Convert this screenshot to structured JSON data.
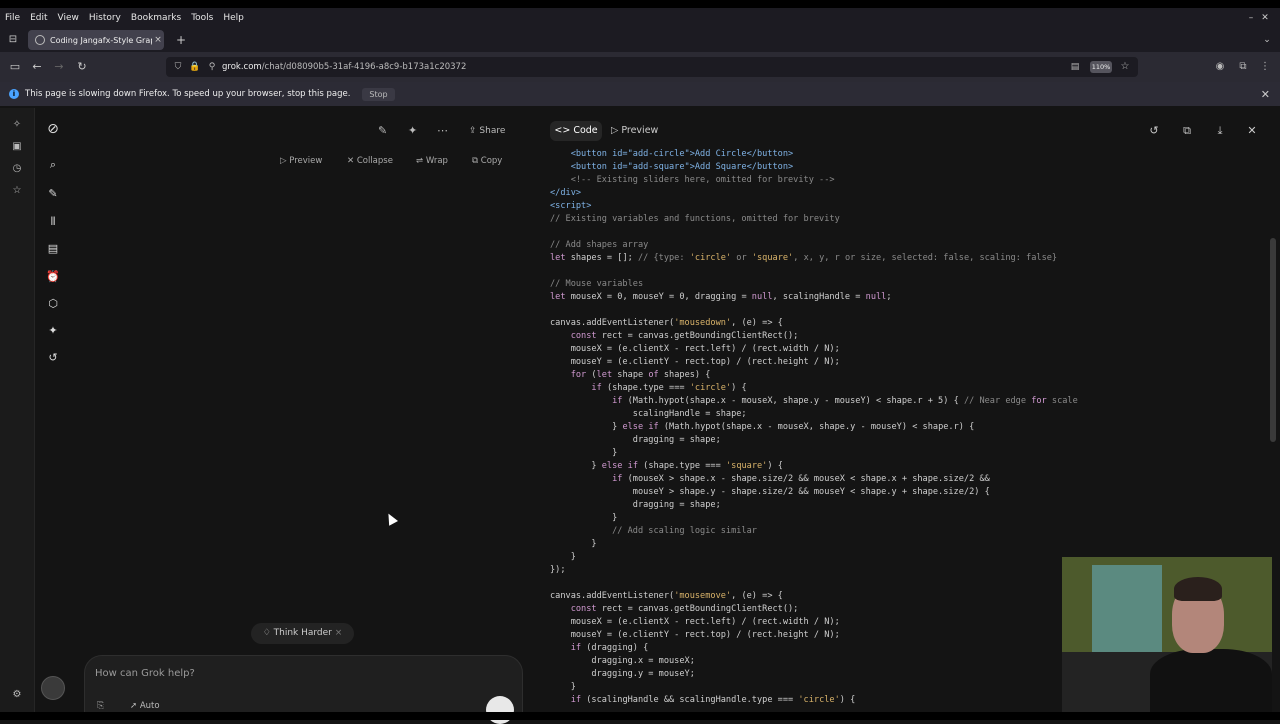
{
  "menubar": {
    "items": [
      "File",
      "Edit",
      "View",
      "History",
      "Bookmarks",
      "Tools",
      "Help"
    ]
  },
  "tab": {
    "title": "Coding Jangafx-Style Graphi",
    "close": "×",
    "new_tab": "+"
  },
  "nav": {
    "url_host": "grok.com",
    "url_path": "/chat/d08090b5-31af-4196-a8c9-b173a1c20372",
    "zoom": "110%"
  },
  "notification": {
    "text": "This page is slowing down Firefox. To speed up your browser, stop this page.",
    "stop_label": "Stop"
  },
  "chat_toolbar": {
    "share_label": "Share"
  },
  "code_controls": {
    "preview": "Preview",
    "collapse": "Collapse",
    "wrap": "Wrap",
    "copy": "Copy"
  },
  "composer": {
    "think_harder": "Think Harder",
    "placeholder": "How can Grok help?",
    "mode": "Auto"
  },
  "code_panel": {
    "tab_code": "Code",
    "tab_preview": "Preview"
  },
  "code": [
    "    <button id=\"add-circle\">Add Circle</button>",
    "    <button id=\"add-square\">Add Square</button>",
    "    <!-- Existing sliders here, omitted for brevity -->",
    "</div>",
    "<script>",
    "// Existing variables and functions, omitted for brevity",
    "",
    "// Add shapes array",
    "let shapes = []; // {type: 'circle' or 'square', x, y, r or size, selected: false, scaling: false}",
    "",
    "// Mouse variables",
    "let mouseX = 0, mouseY = 0, dragging = null, scalingHandle = null;",
    "",
    "canvas.addEventListener('mousedown', (e) => {",
    "    const rect = canvas.getBoundingClientRect();",
    "    mouseX = (e.clientX - rect.left) / (rect.width / N);",
    "    mouseY = (e.clientY - rect.top) / (rect.height / N);",
    "    for (let shape of shapes) {",
    "        if (shape.type === 'circle') {",
    "            if (Math.hypot(shape.x - mouseX, shape.y - mouseY) < shape.r + 5) { // Near edge for scale",
    "                scalingHandle = shape;",
    "            } else if (Math.hypot(shape.x - mouseX, shape.y - mouseY) < shape.r) {",
    "                dragging = shape;",
    "            }",
    "        } else if (shape.type === 'square') {",
    "            if (mouseX > shape.x - shape.size/2 && mouseX < shape.x + shape.size/2 &&",
    "                mouseY > shape.y - shape.size/2 && mouseY < shape.y + shape.size/2) {",
    "                dragging = shape;",
    "            }",
    "            // Add scaling logic similar",
    "        }",
    "    }",
    "});",
    "",
    "canvas.addEventListener('mousemove', (e) => {",
    "    const rect = canvas.getBoundingClientRect();",
    "    mouseX = (e.clientX - rect.left) / (rect.width / N);",
    "    mouseY = (e.clientY - rect.top) / (rect.height / N);",
    "    if (dragging) {",
    "        dragging.x = mouseX;",
    "        dragging.y = mouseY;",
    "    }",
    "    if (scalingHandle && scalingHandle.type === 'circle') {"
  ]
}
